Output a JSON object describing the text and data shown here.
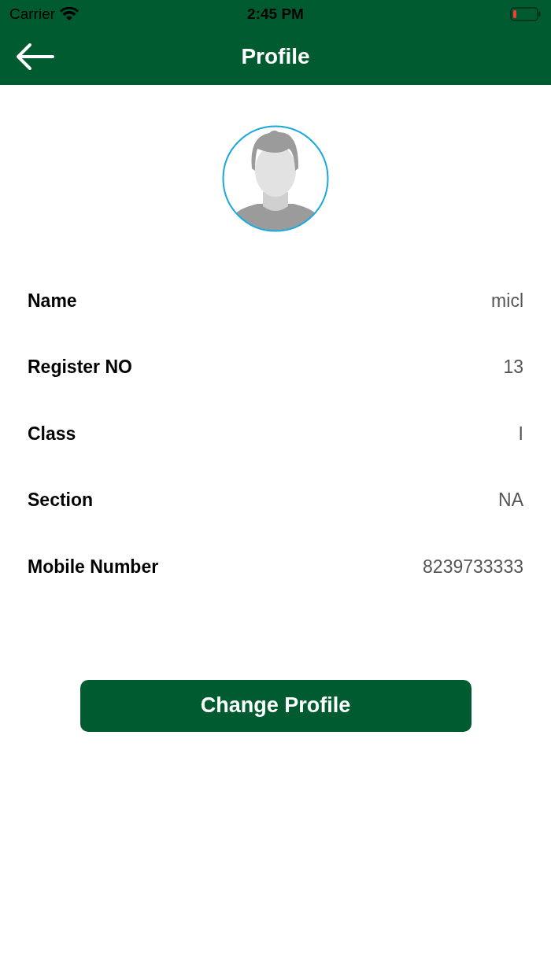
{
  "status_bar": {
    "carrier": "Carrier",
    "time": "2:45 PM"
  },
  "nav_bar": {
    "title": "Profile"
  },
  "fields": [
    {
      "label": "Name",
      "value": "micl"
    },
    {
      "label": "Register NO",
      "value": "13"
    },
    {
      "label": "Class",
      "value": "I"
    },
    {
      "label": "Section",
      "value": "NA"
    },
    {
      "label": "Mobile Number",
      "value": "8239733333"
    }
  ],
  "button": {
    "label": "Change Profile"
  }
}
